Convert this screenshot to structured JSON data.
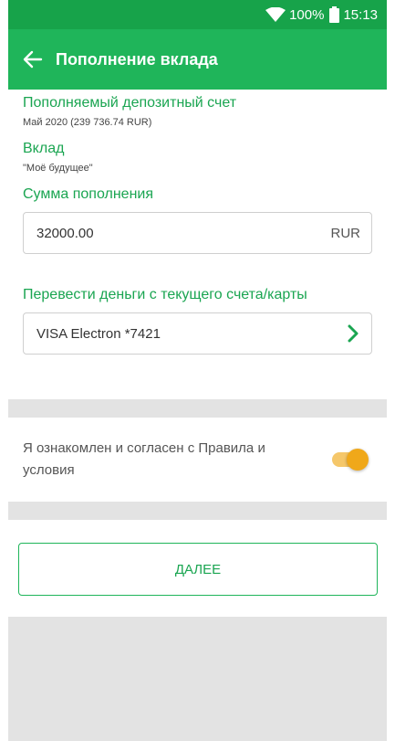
{
  "status_bar": {
    "battery_text": "100%",
    "time": "15:13",
    "icons": [
      "wifi-icon",
      "battery-icon"
    ]
  },
  "app_bar": {
    "title": "Пополнение вклада",
    "back_icon": "arrow-left-icon"
  },
  "deposit_account": {
    "label": "Пополняемый депозитный счет",
    "value": "Май 2020 (239 736.74 RUR)"
  },
  "deposit": {
    "label": "Вклад",
    "value": "\"Моё будущее\""
  },
  "amount": {
    "label": "Сумма пополнения",
    "value": "32000.00",
    "currency": "RUR"
  },
  "source": {
    "label": "Перевести деньги с текущего счета/карты",
    "value": "VISA Electron *7421",
    "icon": "chevron-right-icon"
  },
  "agreement": {
    "text": "Я ознакомлен и согласен с Правила и условия",
    "toggle_on": true
  },
  "next_button": {
    "label": "ДАЛЕЕ"
  },
  "colors": {
    "status_bar": "#17a34a",
    "app_bar": "#1fb55a",
    "accent_green": "#1aa551",
    "toggle_knob": "#f0a81a",
    "toggle_track": "#f5c76a",
    "background": "#e3e3e3"
  }
}
